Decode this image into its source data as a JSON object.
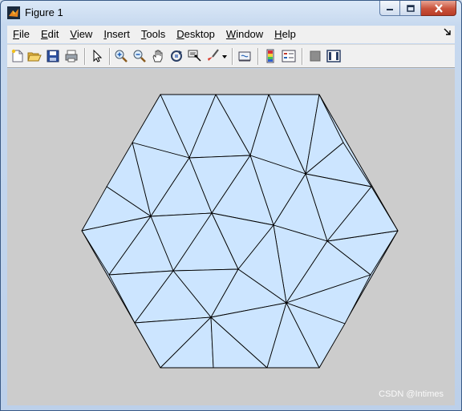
{
  "window": {
    "title": "Figure 1",
    "accent": "#c9523b"
  },
  "menu": {
    "items": [
      {
        "key": "File",
        "label_rest": "ile",
        "label_first": "F"
      },
      {
        "key": "Edit",
        "label_rest": "dit",
        "label_first": "E"
      },
      {
        "key": "View",
        "label_rest": "iew",
        "label_first": "V"
      },
      {
        "key": "Insert",
        "label_rest": "nsert",
        "label_first": "I"
      },
      {
        "key": "Tools",
        "label_rest": "ools",
        "label_first": "T"
      },
      {
        "key": "Desktop",
        "label_rest": "esktop",
        "label_first": "D"
      },
      {
        "key": "Window",
        "label_rest": "indow",
        "label_first": "W"
      },
      {
        "key": "Help",
        "label_rest": "elp",
        "label_first": "H"
      }
    ]
  },
  "toolbar": {
    "icons": [
      "new-figure-icon",
      "open-file-icon",
      "save-icon",
      "print-icon",
      "edit-plot-arrow-icon",
      "zoom-in-icon",
      "zoom-out-icon",
      "pan-hand-icon",
      "rotate-3d-icon",
      "data-cursor-icon",
      "brush-icon",
      "link-plot-icon",
      "colorbar-icon",
      "legend-icon",
      "hide-plot-tools-icon",
      "show-plot-tools-icon"
    ]
  },
  "plot": {
    "fill_color": "#cce5ff",
    "edge_color": "#000000",
    "background": "#cccccc"
  },
  "watermark": "CSDN @Intimes"
}
